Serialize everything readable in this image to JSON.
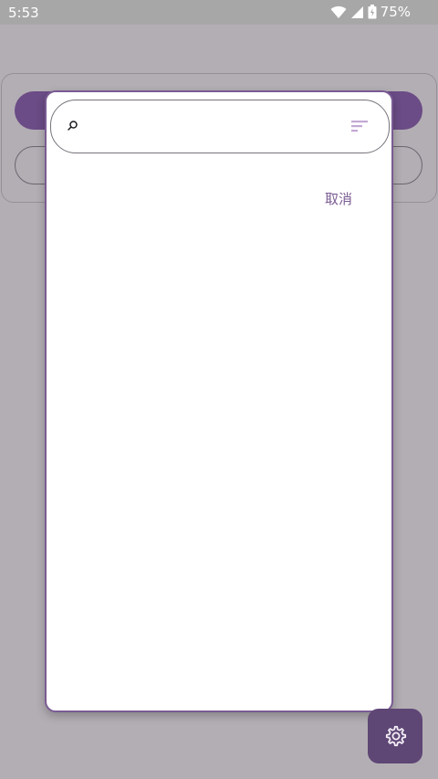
{
  "status_bar": {
    "time": "5:53",
    "battery": "75%"
  },
  "dialog": {
    "search": {
      "value": "",
      "placeholder": ""
    },
    "cancel_label": "取消"
  },
  "colors": {
    "accent": "#7a5b93",
    "fab": "#5e4675",
    "scrim": "#b3aeb4"
  },
  "icons": {
    "search": "search-icon",
    "filter": "filter-sort-icon",
    "settings": "gear-icon",
    "wifi": "wifi-icon",
    "signal": "signal-icon",
    "battery": "battery-icon"
  }
}
